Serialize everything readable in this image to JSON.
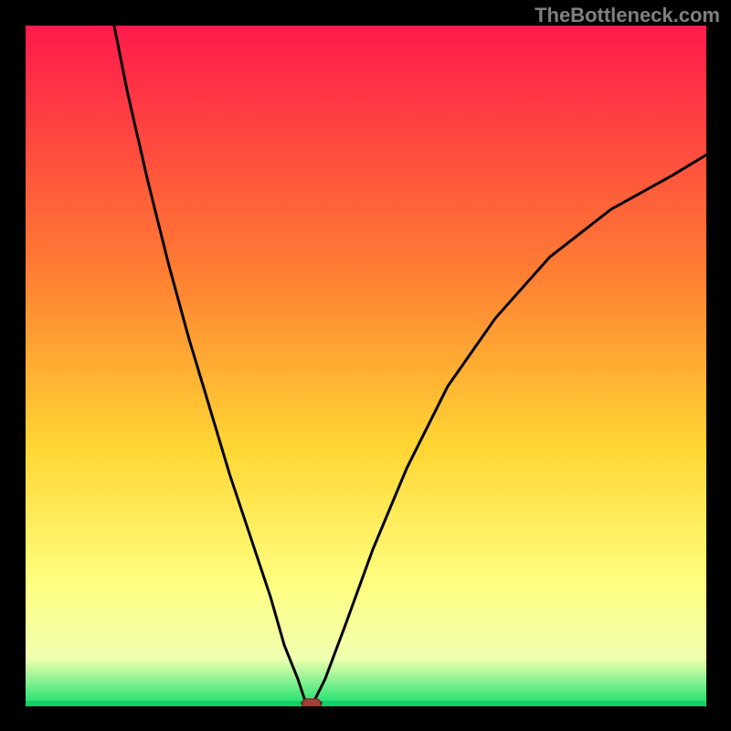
{
  "watermark": "TheBottleneck.com",
  "colors": {
    "frame": "#000000",
    "gradient_top": "#ff1a4c",
    "gradient_mid_upper": "#ff7a33",
    "gradient_mid": "#ffd633",
    "gradient_lower": "#ffff80",
    "gradient_pale": "#f0ffb0",
    "gradient_bottom": "#14e06e",
    "baseline": "#11d168",
    "curve": "#000000",
    "marker_fill": "#a83a3a",
    "marker_stroke": "#7a2a2a"
  },
  "chart_data": {
    "type": "line",
    "title": "",
    "xlabel": "",
    "ylabel": "",
    "x_range": [
      0,
      100
    ],
    "y_range": [
      0,
      100
    ],
    "minimum_x": 42,
    "series": [
      {
        "name": "left-branch",
        "x": [
          13,
          15,
          18,
          21,
          24,
          27,
          30,
          33,
          36,
          38,
          40,
          41,
          42
        ],
        "y": [
          100,
          90,
          77,
          65,
          54,
          44,
          34,
          25,
          16,
          9,
          4,
          1,
          0
        ]
      },
      {
        "name": "right-branch",
        "x": [
          42,
          44,
          47,
          51,
          56,
          62,
          69,
          77,
          86,
          95,
          100
        ],
        "y": [
          0,
          4,
          12,
          23,
          35,
          47,
          57,
          66,
          73,
          78,
          81
        ]
      }
    ],
    "flat_segment": {
      "x": [
        40.5,
        43.5
      ],
      "y": 0.5
    },
    "marker": {
      "x": 42,
      "y": 0
    }
  }
}
